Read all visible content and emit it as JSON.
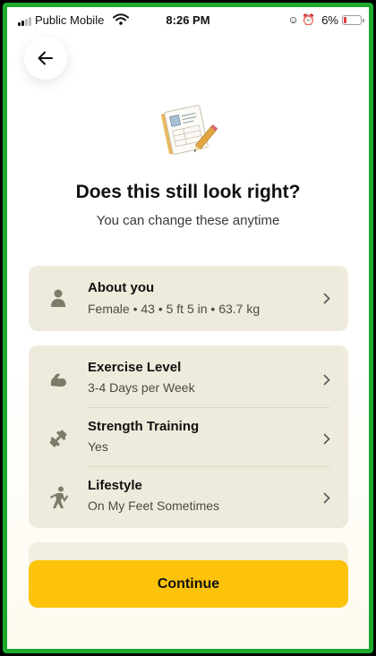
{
  "status_bar": {
    "carrier": "Public Mobile",
    "time": "8:26 PM",
    "battery_percent": "6%",
    "battery_level": 0.06,
    "icons": [
      "signal-icon",
      "wifi-icon",
      "face-id-icon",
      "alarm-icon",
      "battery-icon"
    ]
  },
  "header": {
    "back_icon": "arrow-left-icon",
    "hero_icon": "document-pencil-icon",
    "title": "Does this still look right?",
    "subtitle": "You can change these anytime"
  },
  "cards": {
    "about": {
      "label": "About you",
      "value": "Female • 43 • 5 ft 5 in • 63.7 kg",
      "icon": "person-icon"
    },
    "activity": [
      {
        "label": "Exercise Level",
        "value": "3-4 Days per Week",
        "icon": "flexed-arm-icon"
      },
      {
        "label": "Strength Training",
        "value": "Yes",
        "icon": "dumbbell-icon"
      },
      {
        "label": "Lifestyle",
        "value": "On My Feet Sometimes",
        "icon": "stretching-person-icon"
      }
    ]
  },
  "footer": {
    "continue_label": "Continue"
  },
  "colors": {
    "accent": "#fcc30a",
    "card_bg": "#efebdc",
    "icon_color": "#7d7a6a",
    "frame_border": "#1faa2e"
  }
}
